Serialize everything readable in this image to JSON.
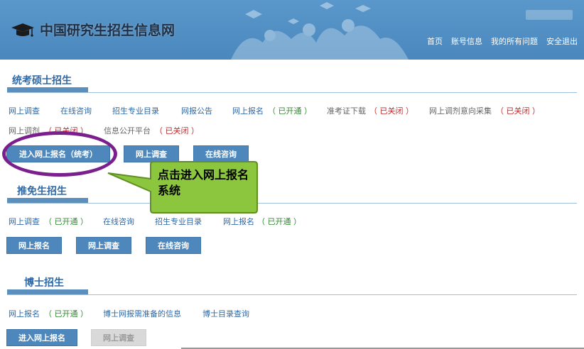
{
  "header": {
    "site_title": "中国研究生招生信息网",
    "nav": [
      "首页",
      "账号信息",
      "我的所有问题",
      "安全退出"
    ]
  },
  "colors": {
    "header_bg": "#4f8fc4",
    "link": "#2f69a6",
    "status_open": "#2e8b2e",
    "status_closed": "#c0282a",
    "button_bg": "#4e87bb",
    "annotation_circle": "#7b1f8f",
    "callout_bg": "#8cc63e"
  },
  "sections": {
    "tongkao": {
      "title": "统考硕士招生",
      "links": {
        "l1": "网上调查",
        "l2": "在线咨询",
        "l3": "招生专业目录",
        "l4": "网报公告",
        "l5": "网上报名",
        "l5_status": "（ 已开通 ）",
        "l6": "准考证下载",
        "l6_status": "（ 已关闭 ）",
        "l7": "网上调剂意向采集",
        "l7_status": "（ 已关闭 ）",
        "l8": "网上调剂",
        "l8_status": "（ 已关闭 ）",
        "l9": "信息公开平台",
        "l9_status": "（ 已关闭 ）"
      },
      "buttons": [
        "进入网上报名（统考）",
        "网上调查",
        "在线咨询"
      ]
    },
    "tuimian": {
      "title": "推免生招生",
      "links": {
        "l1": "网上调查",
        "l1_status": "（ 已开通 ）",
        "l2": "在线咨询",
        "l3": "招生专业目录",
        "l4": "网上报名",
        "l4_status": "（ 已开通 ）"
      },
      "buttons": [
        "网上报名",
        "网上调查",
        "在线咨询"
      ]
    },
    "boshi": {
      "title": "博士招生",
      "links": {
        "l1": "网上报名",
        "l1_status": "（ 已开通 ）",
        "l2": "博士网报需准备的信息",
        "l3": "博士目录查询"
      },
      "buttons": [
        "进入网上报名",
        "网上调查"
      ]
    }
  },
  "annotation": {
    "callout_text": "点击进入网上报名系统"
  }
}
